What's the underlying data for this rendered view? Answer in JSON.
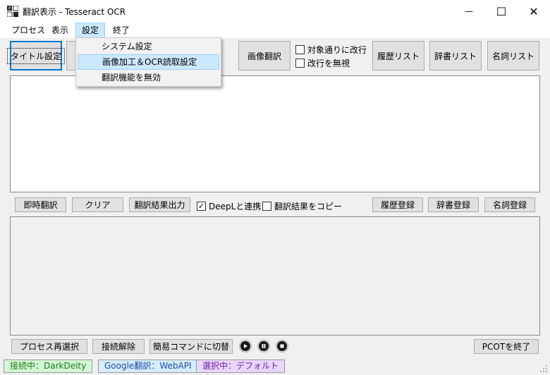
{
  "window": {
    "title": "翻訳表示 - Tesseract OCR",
    "controls": {
      "minimize": "—",
      "maximize": "☐",
      "close": "✕"
    }
  },
  "menubar": {
    "items": [
      {
        "label": "プロセス"
      },
      {
        "label": "表示"
      },
      {
        "label": "設定"
      },
      {
        "label": "終了"
      }
    ]
  },
  "settings_menu": {
    "items": [
      {
        "label": "システム設定"
      },
      {
        "label": "画像加工＆OCR読取設定"
      },
      {
        "label": "翻訳機能を無効"
      }
    ]
  },
  "toolbar": {
    "title_settings": "タイトル設定",
    "image_translate": "画像翻訳",
    "checkbox_newline_per_target": {
      "label": "対象通りに改行",
      "checked": false
    },
    "checkbox_ignore_newline": {
      "label": "改行を無視",
      "checked": false
    },
    "history_list": "履歴リスト",
    "dictionary_list": "辞書リスト",
    "noun_list": "名詞リスト"
  },
  "source_text": "",
  "action_row": {
    "instant_translate": "即時翻訳",
    "clear": "クリア",
    "output_result": "翻訳結果出力",
    "deepl_link": {
      "label": "DeepLと連携",
      "checked": true
    },
    "copy_result": {
      "label": "翻訳結果をコピー",
      "checked": false
    },
    "register_history": "履歴登録",
    "register_dictionary": "辞書登録",
    "register_noun": "名詞登録"
  },
  "result_text": "",
  "bottom_row": {
    "reselect_process": "プロセス再選択",
    "disconnect": "接続解除",
    "switch_simple_command": "簡易コマンドに切替",
    "media": [
      "play-icon",
      "pause-icon",
      "stop-icon"
    ],
    "exit_pcot": "PCOTを終了"
  },
  "statusbar": {
    "connection": "接続中：DarkDeity",
    "translator": "Google翻訳：WebAPI",
    "selection": "選択中：デフォルト",
    "colors": {
      "connection_bg": "#d4f7d4",
      "connection_fg": "#1a7a1a",
      "translator_bg": "#d6ecff",
      "translator_fg": "#1a4fa0",
      "selection_bg": "#e9d6ff",
      "selection_fg": "#6a1fa0"
    }
  }
}
